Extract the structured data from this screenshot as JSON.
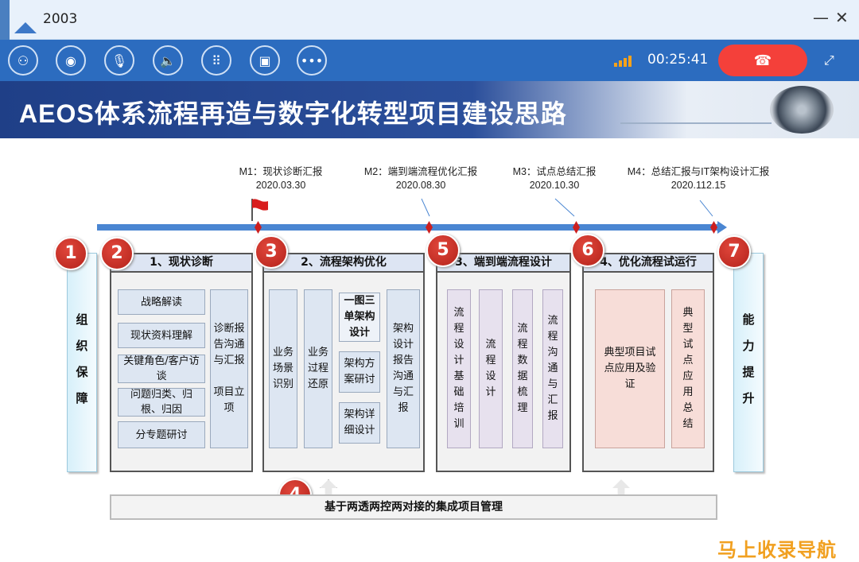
{
  "window": {
    "title": "2003",
    "minimize_glyph": "—",
    "close_glyph": "✕"
  },
  "toolbar": {
    "icons": [
      "participants-icon",
      "camera-icon",
      "mute-icon",
      "speaker-icon",
      "keypad-icon",
      "screen-share-icon",
      "more-icon"
    ],
    "icon_glyphs": [
      "⚇",
      "◉",
      "🎙",
      "🔈",
      "⠿",
      "▣",
      "•••"
    ],
    "timer": "00:25:41",
    "hangup_glyph": "☎",
    "expand_glyph": "⤢"
  },
  "slide": {
    "title": "AEOS体系流程再造与数字化转型项目建设思路",
    "milestones": [
      {
        "label": "M1：现状诊断汇报",
        "date": "2020.03.30"
      },
      {
        "label": "M2：端到端流程优化汇报",
        "date": "2020.08.30"
      },
      {
        "label": "M3：试点总结汇报",
        "date": "2020.10.30"
      },
      {
        "label": "M4：总结汇报与IT架构设计汇报",
        "date": "2020.112.15"
      }
    ],
    "left_side": [
      "组",
      "织",
      "保",
      "障"
    ],
    "right_side": [
      "能",
      "力",
      "提",
      "升"
    ],
    "numbers": [
      "1",
      "2",
      "3",
      "4",
      "5",
      "6",
      "7"
    ],
    "panel1": {
      "title": "1、现状诊断",
      "items": [
        "战略解读",
        "现状资料理解",
        "关键角色/客户访谈",
        "问题归类、归根、归因",
        "分专题研讨"
      ],
      "right_box": "诊断报告沟通与汇报\n\n项目立项"
    },
    "panel2": {
      "title": "2、流程架构优化",
      "col1": "业务场景识别",
      "col2": "业务过程还原",
      "mid_top": "一图三单架构设计",
      "mid_mid": "架构方案研讨",
      "mid_bot": "架构详细设计",
      "col4": "架构设计报告沟通与汇报"
    },
    "panel3": {
      "title": "3、端到端流程设计",
      "cols": [
        "流程设计基础培训",
        "流程设计",
        "流程数据梳理",
        "流程沟通与汇报"
      ]
    },
    "panel4": {
      "title": "4、优化流程试运行",
      "left": "典型项目试点应用及验证",
      "right": "典型试点应用总结"
    },
    "bottom_bar": "基于两透两控两对接的集成项目管理"
  },
  "watermark": "马上收录导航"
}
